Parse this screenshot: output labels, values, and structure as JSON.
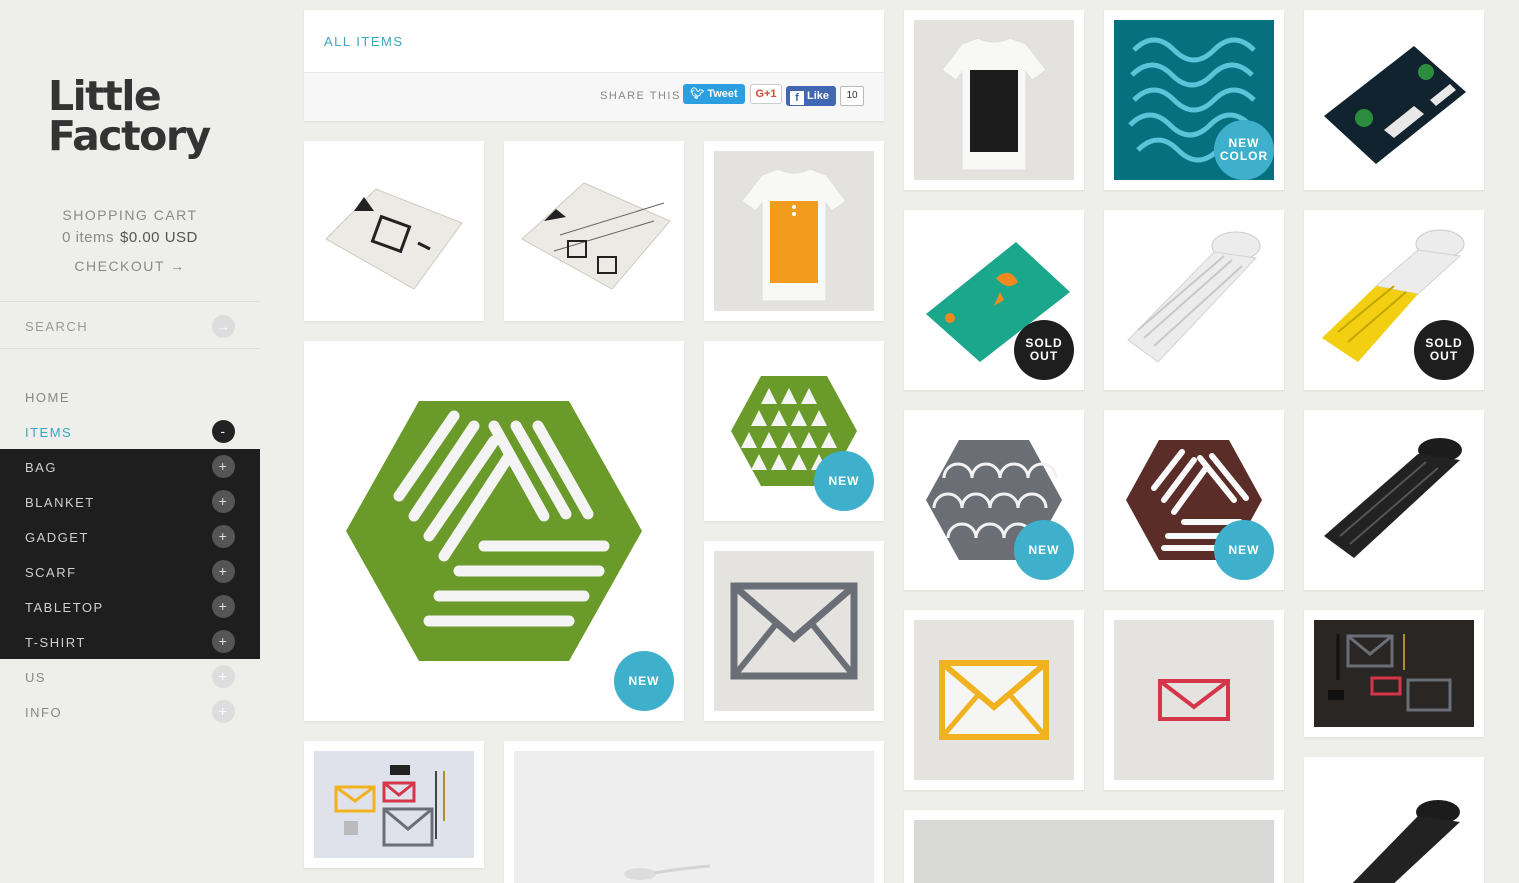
{
  "brand": {
    "line1": "Little",
    "line2": "Factory"
  },
  "cart": {
    "title": "SHOPPING CART",
    "items": "0 items",
    "total": "$0.00 USD",
    "checkout": "CHECKOUT →"
  },
  "search": {
    "label": "SEARCH",
    "icon": "→"
  },
  "nav": {
    "home": "HOME",
    "items": "ITEMS",
    "items_toggle": "-",
    "sub": [
      "BAG",
      "BLANKET",
      "GADGET",
      "SCARF",
      "TABLETOP",
      "T-SHIRT"
    ],
    "us": "US",
    "info": "INFO",
    "plus": "+"
  },
  "header": {
    "title": "ALL ITEMS",
    "share_label": "SHARE THIS",
    "tweet": "Tweet",
    "gplus": "G+1",
    "fb_like": "Like",
    "fb_count": "10"
  },
  "badges": {
    "new": "NEW",
    "new_color_1": "NEW",
    "new_color_2": "COLOR",
    "sold_1": "SOLD",
    "sold_2": "OUT"
  },
  "colors": {
    "accent": "#3aa6c0",
    "badge_new": "#3eb0cc",
    "badge_sold": "#1e1e1e",
    "felt_green": "#6a9a2a"
  }
}
